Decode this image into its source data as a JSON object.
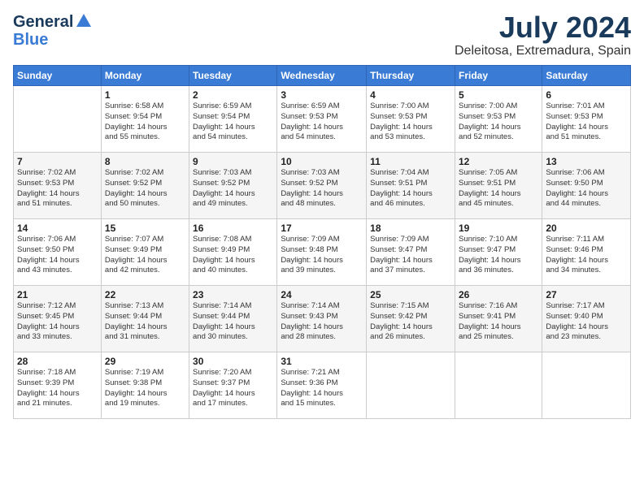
{
  "logo": {
    "line1": "General",
    "line2": "Blue"
  },
  "title": "July 2024",
  "location": "Deleitosa, Extremadura, Spain",
  "headers": [
    "Sunday",
    "Monday",
    "Tuesday",
    "Wednesday",
    "Thursday",
    "Friday",
    "Saturday"
  ],
  "weeks": [
    [
      {
        "day": "",
        "info": ""
      },
      {
        "day": "1",
        "info": "Sunrise: 6:58 AM\nSunset: 9:54 PM\nDaylight: 14 hours\nand 55 minutes."
      },
      {
        "day": "2",
        "info": "Sunrise: 6:59 AM\nSunset: 9:54 PM\nDaylight: 14 hours\nand 54 minutes."
      },
      {
        "day": "3",
        "info": "Sunrise: 6:59 AM\nSunset: 9:53 PM\nDaylight: 14 hours\nand 54 minutes."
      },
      {
        "day": "4",
        "info": "Sunrise: 7:00 AM\nSunset: 9:53 PM\nDaylight: 14 hours\nand 53 minutes."
      },
      {
        "day": "5",
        "info": "Sunrise: 7:00 AM\nSunset: 9:53 PM\nDaylight: 14 hours\nand 52 minutes."
      },
      {
        "day": "6",
        "info": "Sunrise: 7:01 AM\nSunset: 9:53 PM\nDaylight: 14 hours\nand 51 minutes."
      }
    ],
    [
      {
        "day": "7",
        "info": "Sunrise: 7:02 AM\nSunset: 9:53 PM\nDaylight: 14 hours\nand 51 minutes."
      },
      {
        "day": "8",
        "info": "Sunrise: 7:02 AM\nSunset: 9:52 PM\nDaylight: 14 hours\nand 50 minutes."
      },
      {
        "day": "9",
        "info": "Sunrise: 7:03 AM\nSunset: 9:52 PM\nDaylight: 14 hours\nand 49 minutes."
      },
      {
        "day": "10",
        "info": "Sunrise: 7:03 AM\nSunset: 9:52 PM\nDaylight: 14 hours\nand 48 minutes."
      },
      {
        "day": "11",
        "info": "Sunrise: 7:04 AM\nSunset: 9:51 PM\nDaylight: 14 hours\nand 46 minutes."
      },
      {
        "day": "12",
        "info": "Sunrise: 7:05 AM\nSunset: 9:51 PM\nDaylight: 14 hours\nand 45 minutes."
      },
      {
        "day": "13",
        "info": "Sunrise: 7:06 AM\nSunset: 9:50 PM\nDaylight: 14 hours\nand 44 minutes."
      }
    ],
    [
      {
        "day": "14",
        "info": "Sunrise: 7:06 AM\nSunset: 9:50 PM\nDaylight: 14 hours\nand 43 minutes."
      },
      {
        "day": "15",
        "info": "Sunrise: 7:07 AM\nSunset: 9:49 PM\nDaylight: 14 hours\nand 42 minutes."
      },
      {
        "day": "16",
        "info": "Sunrise: 7:08 AM\nSunset: 9:49 PM\nDaylight: 14 hours\nand 40 minutes."
      },
      {
        "day": "17",
        "info": "Sunrise: 7:09 AM\nSunset: 9:48 PM\nDaylight: 14 hours\nand 39 minutes."
      },
      {
        "day": "18",
        "info": "Sunrise: 7:09 AM\nSunset: 9:47 PM\nDaylight: 14 hours\nand 37 minutes."
      },
      {
        "day": "19",
        "info": "Sunrise: 7:10 AM\nSunset: 9:47 PM\nDaylight: 14 hours\nand 36 minutes."
      },
      {
        "day": "20",
        "info": "Sunrise: 7:11 AM\nSunset: 9:46 PM\nDaylight: 14 hours\nand 34 minutes."
      }
    ],
    [
      {
        "day": "21",
        "info": "Sunrise: 7:12 AM\nSunset: 9:45 PM\nDaylight: 14 hours\nand 33 minutes."
      },
      {
        "day": "22",
        "info": "Sunrise: 7:13 AM\nSunset: 9:44 PM\nDaylight: 14 hours\nand 31 minutes."
      },
      {
        "day": "23",
        "info": "Sunrise: 7:14 AM\nSunset: 9:44 PM\nDaylight: 14 hours\nand 30 minutes."
      },
      {
        "day": "24",
        "info": "Sunrise: 7:14 AM\nSunset: 9:43 PM\nDaylight: 14 hours\nand 28 minutes."
      },
      {
        "day": "25",
        "info": "Sunrise: 7:15 AM\nSunset: 9:42 PM\nDaylight: 14 hours\nand 26 minutes."
      },
      {
        "day": "26",
        "info": "Sunrise: 7:16 AM\nSunset: 9:41 PM\nDaylight: 14 hours\nand 25 minutes."
      },
      {
        "day": "27",
        "info": "Sunrise: 7:17 AM\nSunset: 9:40 PM\nDaylight: 14 hours\nand 23 minutes."
      }
    ],
    [
      {
        "day": "28",
        "info": "Sunrise: 7:18 AM\nSunset: 9:39 PM\nDaylight: 14 hours\nand 21 minutes."
      },
      {
        "day": "29",
        "info": "Sunrise: 7:19 AM\nSunset: 9:38 PM\nDaylight: 14 hours\nand 19 minutes."
      },
      {
        "day": "30",
        "info": "Sunrise: 7:20 AM\nSunset: 9:37 PM\nDaylight: 14 hours\nand 17 minutes."
      },
      {
        "day": "31",
        "info": "Sunrise: 7:21 AM\nSunset: 9:36 PM\nDaylight: 14 hours\nand 15 minutes."
      },
      {
        "day": "",
        "info": ""
      },
      {
        "day": "",
        "info": ""
      },
      {
        "day": "",
        "info": ""
      }
    ]
  ]
}
